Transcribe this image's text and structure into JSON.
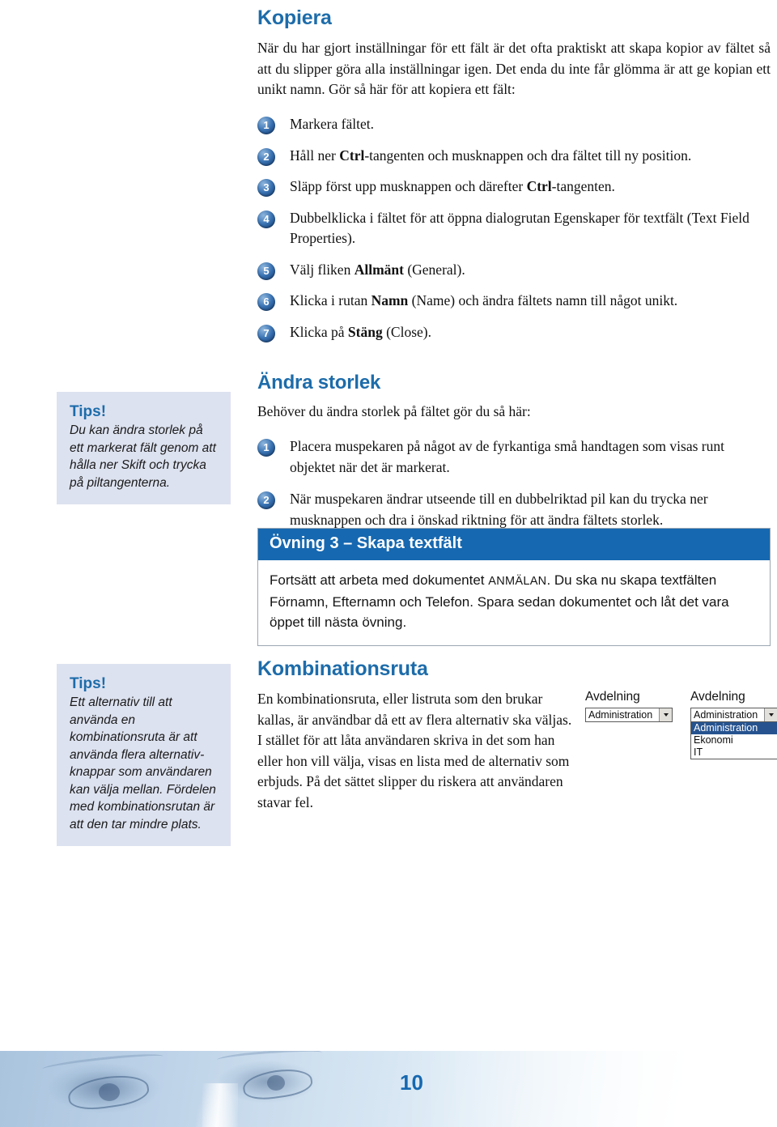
{
  "sections": {
    "kopiera": {
      "title": "Kopiera",
      "intro": "När du har gjort inställningar för ett fält är det ofta praktiskt att skapa kopior av fältet så att du slipper göra alla inställningar igen. Det enda du inte får glömma är att ge kopian ett unikt namn. Gör så här för att kopiera ett fält:",
      "steps": [
        {
          "num": "1",
          "pre": "Markera fältet.",
          "bold": "",
          "post": ""
        },
        {
          "num": "2",
          "pre": "Håll ner ",
          "bold": "Ctrl",
          "post": "-tangenten och musknappen och dra fältet till ny position."
        },
        {
          "num": "3",
          "pre": "Släpp först upp musknappen och därefter ",
          "bold": "Ctrl",
          "post": "-tangenten."
        },
        {
          "num": "4",
          "pre": "Dubbelklicka i fältet för att öppna dialogrutan Egenskaper för textfält (Text Field Properties).",
          "bold": "",
          "post": ""
        },
        {
          "num": "5",
          "pre": "Välj fliken ",
          "bold": "Allmänt",
          "post": " (General)."
        },
        {
          "num": "6",
          "pre": "Klicka i rutan ",
          "bold": "Namn",
          "post": " (Name) och ändra fältets namn till något unikt."
        },
        {
          "num": "7",
          "pre": "Klicka på ",
          "bold": "Stäng",
          "post": " (Close)."
        }
      ]
    },
    "andra_storlek": {
      "title": "Ändra storlek",
      "intro": "Behöver du ändra storlek på fältet gör du så här:",
      "steps": [
        {
          "num": "1",
          "pre": "Placera muspekaren på något av de fyrkantiga små handtagen som visas runt objektet när det är markerat.",
          "bold": "",
          "post": ""
        },
        {
          "num": "2",
          "pre": "När muspekaren ändrar utseende till en dubbelriktad pil kan du trycka ner musknappen och dra i önskad riktning för att ändra fältets storlek.",
          "bold": "",
          "post": ""
        }
      ]
    },
    "kombinationsruta": {
      "title": "Kombinationsruta",
      "body": "En kombinationsruta, eller listruta som den brukar kallas, är användbar då ett av flera alternativ ska väljas. I stället för att låta användaren skriva in det som han eller hon vill välja, visas en lista med de alternativ som erbjuds. På det sättet slipper du riskera att användaren stavar fel."
    }
  },
  "tips": [
    {
      "title": "Tips!",
      "body": "Du kan ändra storlek på ett markerat fält genom att hålla ner Skift och trycka på piltangenterna."
    },
    {
      "title": "Tips!",
      "body": "Ett alternativ till att använda en kombinationsruta är att använda flera alternativ-knappar som användaren kan välja mellan. Fördelen med kombinationsrutan är att den tar mindre plats."
    }
  ],
  "exercise": {
    "header": "Övning 3 – Skapa textfält",
    "body_part1": "Fortsätt att arbeta med dokumentet ",
    "body_doc_name": "ANMÄLAN",
    "body_part2": ". Du ska nu skapa textfälten Förnamn, Efternamn och Telefon. Spara sedan dokumentet och låt det vara öppet till nästa övning."
  },
  "combo_figure": {
    "closed": {
      "label": "Avdelning",
      "value": "Administration"
    },
    "open": {
      "label": "Avdelning",
      "value": "Administration",
      "options": [
        "Administration",
        "Ekonomi",
        "IT"
      ],
      "selected_index": 0
    }
  },
  "footer": {
    "page_number": "10"
  },
  "colors": {
    "heading_blue": "#1d6caa",
    "bar_blue": "#1668b0",
    "tips_bg": "#dde2f0",
    "selected_option": "#26538f"
  }
}
